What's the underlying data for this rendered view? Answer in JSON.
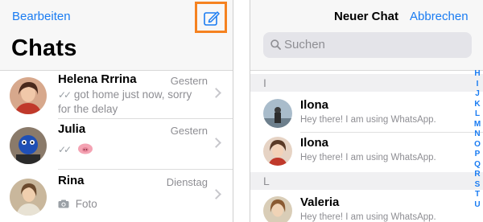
{
  "left": {
    "edit_label": "Bearbeiten",
    "title": "Chats",
    "chats": [
      {
        "name": "Helena Rrrina",
        "time": "Gestern",
        "message": "got home just now, sorry for the delay"
      },
      {
        "name": "Julia",
        "time": "Gestern",
        "message": ""
      },
      {
        "name": "Rina",
        "time": "Dienstag",
        "message": "Foto"
      }
    ]
  },
  "right": {
    "title": "Neuer Chat",
    "cancel_label": "Abbrechen",
    "search_placeholder": "Suchen",
    "sections": [
      {
        "letter": "I",
        "contacts": [
          {
            "name": "Ilona",
            "status": "Hey there! I am using WhatsApp."
          },
          {
            "name": "Ilona",
            "status": "Hey there! I am using WhatsApp."
          }
        ]
      },
      {
        "letter": "L",
        "contacts": []
      },
      {
        "letter": "",
        "contacts": [
          {
            "name": "Valeria",
            "status": "Hey there! I am using WhatsApp."
          }
        ]
      }
    ],
    "index_letters": [
      "H",
      "I",
      "J",
      "K",
      "L",
      "M",
      "N",
      "O",
      "P",
      "Q",
      "R",
      "S",
      "T",
      "U"
    ]
  },
  "colors": {
    "accent": "#1a7cf2",
    "highlight": "#f58220"
  },
  "icons": [
    "compose-icon",
    "search-icon",
    "double-check-icon",
    "camera-icon",
    "chevron-right-icon"
  ]
}
